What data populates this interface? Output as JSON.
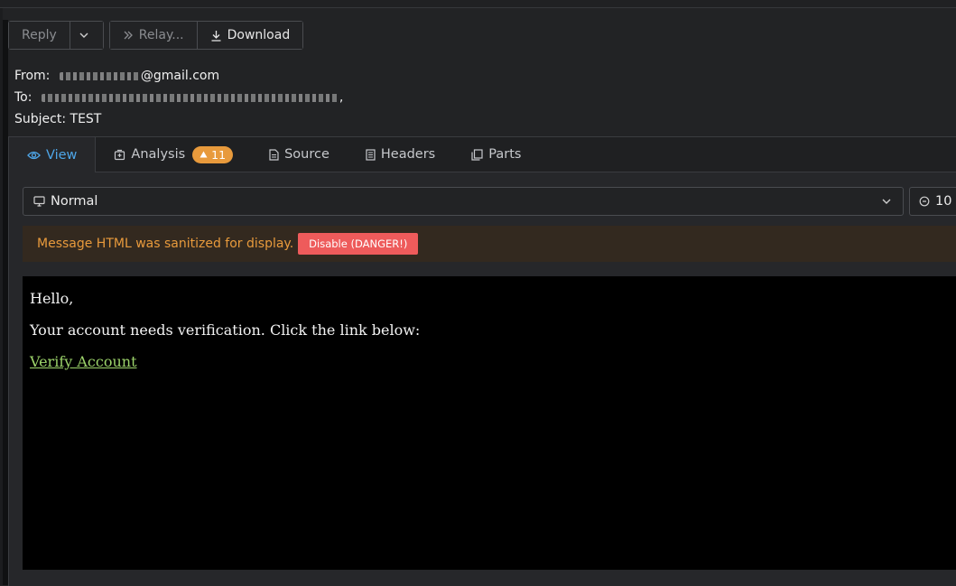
{
  "toolbar": {
    "reply_label": "Reply",
    "relay_label": "Relay...",
    "download_label": "Download"
  },
  "header": {
    "from_label": "From:",
    "from_value_visible": "@gmail.com",
    "to_label": "To:",
    "to_value_visible": ",",
    "subject_label": "Subject:",
    "subject_value": "TEST"
  },
  "tabs": [
    {
      "label": "View",
      "icon": "eye-icon",
      "active": true
    },
    {
      "label": "Analysis",
      "icon": "analysis-icon",
      "badge": "11"
    },
    {
      "label": "Source",
      "icon": "file-icon"
    },
    {
      "label": "Headers",
      "icon": "list-icon"
    },
    {
      "label": "Parts",
      "icon": "copy-icon"
    }
  ],
  "view_mode": {
    "selected": "Normal",
    "icon": "monitor-icon"
  },
  "zoom": {
    "value": "10",
    "icon": "zoom-icon"
  },
  "warning": {
    "text": "Message HTML was sanitized for display.",
    "button_label": "Disable (DANGER!)"
  },
  "message": {
    "greeting": "Hello,",
    "body": "Your account needs verification. Click the link below:",
    "link_text": "Verify Account"
  },
  "colors": {
    "accent": "#4ea6e8",
    "warning": "#e89a3c",
    "danger": "#ee5b5b",
    "link": "#9cd36a"
  }
}
